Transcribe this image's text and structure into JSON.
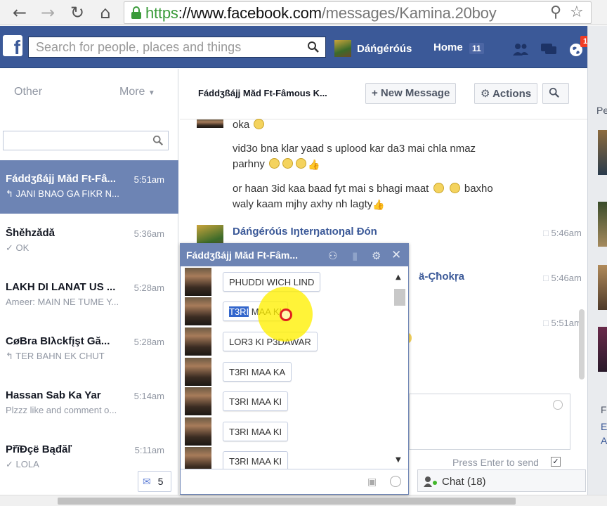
{
  "browser": {
    "url_scheme": "https",
    "url_host": "://www.facebook.com",
    "url_path": "/messages/Kamina.20boy",
    "back_icon": "arrow-left-icon",
    "forward_icon": "arrow-right-icon",
    "reload_icon": "reload-icon",
    "home_icon": "home-icon"
  },
  "fb": {
    "logo": "f",
    "search_placeholder": "Search for people, places and things",
    "user_name": "Dáńgéróús",
    "home_label": "Home",
    "home_count": "11",
    "notif_count": "1",
    "brand_color": "#3b5998"
  },
  "left": {
    "other_label": "Other",
    "more_label": "More",
    "threads": [
      {
        "name": "Fáddʒßájj Măd Ft-Fâ...",
        "time": "5:51am",
        "preview": "↰ JANI BNAO GA FIKR N..."
      },
      {
        "name": "Šhěhzǎdǎ",
        "time": "5:36am",
        "preview": "✓ OK"
      },
      {
        "name": "LAKH DI LANAT US ...",
        "time": "5:28am",
        "preview": "Ameer: MAIN NE TUME Y..."
      },
      {
        "name": "CøBra BIλckfįşt Gă...",
        "time": "5:28am",
        "preview": "↰ TER BAHN EK CHUT"
      },
      {
        "name": "Hassan Sab Ka Yar",
        "time": "5:14am",
        "preview": "Plzzz like and comment o..."
      },
      {
        "name": "PřĩĐçë Bąđăľ",
        "time": "5:11am",
        "preview": "✓ LOLA"
      }
    ],
    "chat_count": "5"
  },
  "conversation": {
    "title": "Fáddʒßájj Măd Ft-Fâmous K...",
    "new_message_label": "+ New Message",
    "actions_label": "Actions",
    "messages": {
      "m1": "oka",
      "m2": "vid3o bna klar yaad s uplood kar da3 mai chla nmaz",
      "m3": "parhny",
      "m4": "or haan 3id kaa baad fyt mai s bhagi maat",
      "m5": "baxho",
      "m6": "waly kaam mjhy axhy nh lagty",
      "sender1": "Dáńgéróús Iŋterŋatıoŋal Đón",
      "time1": "5:46am",
      "sender2_fragment": "ä-Çħokŗa",
      "time2": "5:46am",
      "time3": "5:51am"
    },
    "composer_hint": "Press Enter to send",
    "chat_label": "Chat (18)"
  },
  "chat_window": {
    "title": "Fáddʒßájj Măd Ft-Fâm...",
    "rows": [
      {
        "text": "PHUDDI WICH LIND",
        "highlight": ""
      },
      {
        "text": " MAA KI",
        "highlight": "T3RI"
      },
      {
        "text": "LOR3 KI P3DAWAR",
        "highlight": ""
      },
      {
        "text": "T3RI MAA KA",
        "highlight": ""
      },
      {
        "text": "T3RI MAA KI",
        "highlight": ""
      },
      {
        "text": "T3RI MAA KI",
        "highlight": ""
      },
      {
        "text": "T3RI MAA KI",
        "highlight": ""
      }
    ]
  },
  "right": {
    "fragment_top": "Pe",
    "fragment_f": "F",
    "fragment_e": "E",
    "fragment_a": "A"
  }
}
